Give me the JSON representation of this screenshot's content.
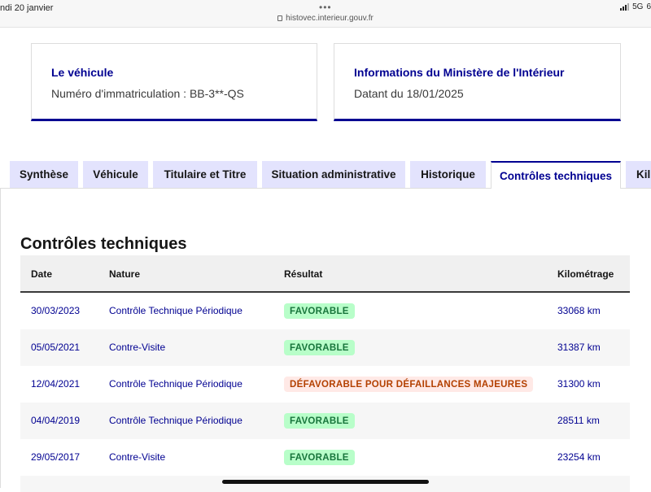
{
  "status": {
    "time": "ndi 20 janvier",
    "dots": "•••",
    "url": "histovec.interieur.gouv.fr",
    "network": "5G",
    "battery": "6"
  },
  "cards": {
    "vehicle": {
      "title": "Le véhicule",
      "text": "Numéro d'immatriculation : BB-3**-QS"
    },
    "ministry": {
      "title": "Informations du Ministère de l'Intérieur",
      "text": "Datant du 18/01/2025"
    }
  },
  "tabs": [
    {
      "label": "Synthèse"
    },
    {
      "label": "Véhicule"
    },
    {
      "label": "Titulaire et Titre"
    },
    {
      "label": "Situation administrative"
    },
    {
      "label": "Historique"
    },
    {
      "label": "Contrôles techniques"
    },
    {
      "label": "Kil"
    }
  ],
  "section_title": "Contrôles techniques",
  "table": {
    "headers": {
      "date": "Date",
      "nature": "Nature",
      "result": "Résultat",
      "km": "Kilométrage"
    },
    "rows": [
      {
        "date": "30/03/2023",
        "nature": "Contrôle Technique Périodique",
        "result": "FAVORABLE",
        "km": "33068 km"
      },
      {
        "date": "05/05/2021",
        "nature": "Contre-Visite",
        "result": "FAVORABLE",
        "km": "31387 km"
      },
      {
        "date": "12/04/2021",
        "nature": "Contrôle Technique Périodique",
        "result": "DÉFAVORABLE POUR DÉFAILLANCES MAJEURES",
        "km": "31300 km"
      },
      {
        "date": "04/04/2019",
        "nature": "Contrôle Technique Périodique",
        "result": "FAVORABLE",
        "km": "28511 km"
      },
      {
        "date": "29/05/2017",
        "nature": "Contre-Visite",
        "result": "FAVORABLE",
        "km": "23254 km"
      }
    ]
  },
  "colors": {
    "primary": "#000091",
    "tab_bg": "#e3e3fd",
    "success_bg": "#b8fec9",
    "success_text": "#18753c",
    "error_bg": "#ffe9e6",
    "error_text": "#b34000"
  }
}
